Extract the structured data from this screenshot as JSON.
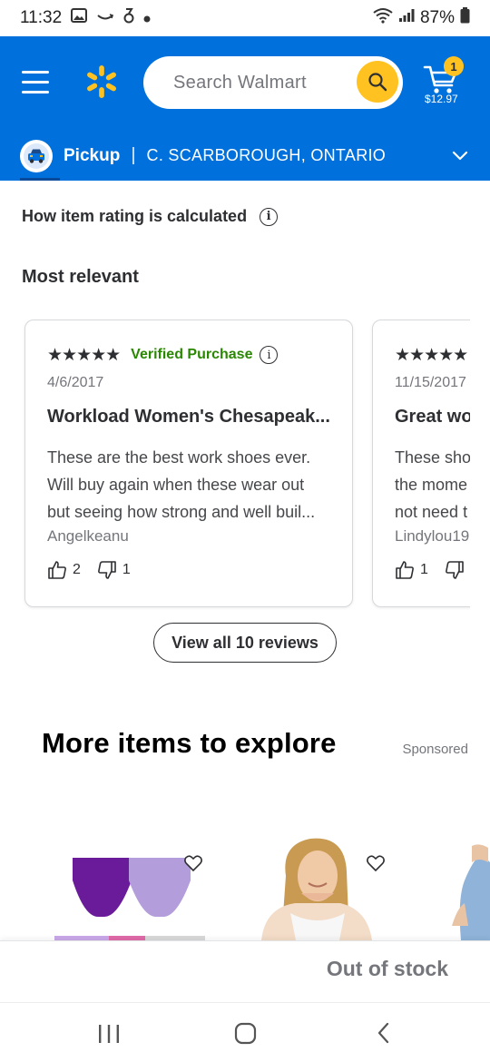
{
  "status_bar": {
    "time": "11:32",
    "battery": "87%"
  },
  "header": {
    "search_placeholder": "Search Walmart",
    "cart_count": "1",
    "cart_total": "$12.97"
  },
  "pickup": {
    "label": "Pickup",
    "separator": "|",
    "location": "C. SCARBOROUGH, ONTARIO"
  },
  "rating_info": {
    "label": "How item rating is calculated",
    "info_glyph": "i"
  },
  "section": {
    "sort_label": "Most relevant"
  },
  "reviews": [
    {
      "stars": "★★★★★",
      "verified": "Verified Purchase",
      "info_glyph": "i",
      "date": "4/6/2017",
      "title": "Workload Women's Chesapeak...",
      "body": "These are the best work shoes ever. Will buy again when these wear out but seeing how strong and well buil...",
      "author": "Angelkeanu",
      "helpful": "2",
      "unhelpful": "1"
    },
    {
      "stars": "★★★★★",
      "date": "11/15/2017",
      "title": "Great wo",
      "body": "These sho the mome not need t",
      "author": "Lindylou19",
      "helpful": "1"
    }
  ],
  "view_all": {
    "label": "View all 10 reviews"
  },
  "explore": {
    "title": "More items to explore",
    "sponsored": "Sponsored"
  },
  "bottom_bar": {
    "status": "Out of stock"
  },
  "colors": {
    "brand_blue": "#0071dc",
    "spark_yellow": "#ffc220",
    "verified_green": "#2a8703",
    "text_dark": "#2e2f32",
    "text_muted": "#74767c"
  },
  "icons": [
    "menu-icon",
    "walmart-spark-icon",
    "search-icon",
    "cart-icon",
    "car-icon",
    "chevron-down-icon",
    "info-icon",
    "thumbs-up-icon",
    "thumbs-down-icon",
    "heart-icon",
    "recents-icon",
    "home-icon",
    "back-icon"
  ]
}
